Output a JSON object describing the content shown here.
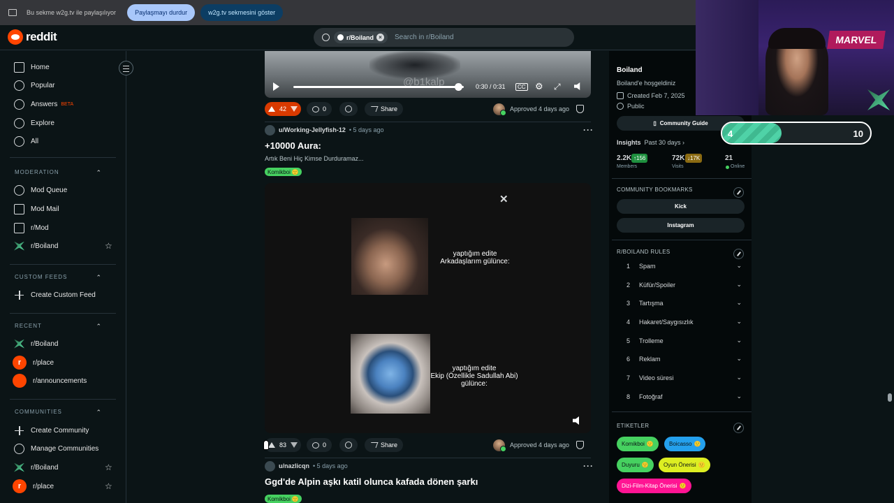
{
  "sharebar": {
    "message": "Bu sekme w2g.tv ile paylaşılıyor",
    "stop_label": "Paylaşmayı durdur",
    "show_label": "w2g.tv sekmesini göster"
  },
  "header": {
    "logo_text": "reddit",
    "search_chip": "r/Boiland",
    "search_placeholder": "Search in r/Boiland"
  },
  "sidebar": {
    "main": [
      "Home",
      "Popular",
      "Answers",
      "Explore",
      "All"
    ],
    "answers_badge": "BETA",
    "moderation_title": "MODERATION",
    "moderation": [
      "Mod Queue",
      "Mod Mail",
      "r/Mod",
      "r/Boiland"
    ],
    "custom_feeds_title": "CUSTOM FEEDS",
    "create_custom_feed": "Create Custom Feed",
    "recent_title": "RECENT",
    "recent": [
      "r/Boiland",
      "r/place",
      "r/announcements"
    ],
    "communities_title": "COMMUNITIES",
    "create_community": "Create Community",
    "manage_communities": "Manage Communities",
    "communities": [
      "r/Boiland",
      "r/place"
    ]
  },
  "feed": {
    "video": {
      "time": "0:30 / 0:31",
      "watermark": "@b1kalp",
      "progress": 0.97
    },
    "post0": {
      "votes": "42",
      "comments": "0",
      "share": "Share",
      "approved": "Approved 4 days ago"
    },
    "post1": {
      "user": "u/Working-Jellyfish-12",
      "age": "• 5 days ago",
      "title": "+10000 Aura:",
      "body": "Artık Beni Hiç Kimse Durduramaz...",
      "flair": "Komikboi",
      "caption1": "yaptığım edite\nArkadaşlarım gülünce:",
      "caption2": "yaptığım edite\nEkip (Özellikle Sadullah Abi)\ngülünce:",
      "votes": "83",
      "comments": "0",
      "share": "Share",
      "approved": "Approved 4 days ago"
    },
    "post2": {
      "user": "u/nazlicqn",
      "age": "• 5 days ago",
      "title": "Ggd'de Alpin aşkı katil olunca kafada dönen şarkı",
      "flair": "Komikboi"
    }
  },
  "rightbar": {
    "name": "Boiland",
    "welcome": "Boiland'e hoşgeldiniz",
    "created": "Created Feb 7, 2025",
    "visibility": "Public",
    "guide_button": "Community Guide",
    "insights_label": "Insights",
    "insights_period": "Past 30 days ›",
    "members": "2.2K",
    "members_label": "Members",
    "members_delta": "↑156",
    "visits": "72K",
    "visits_label": "Visits",
    "visits_delta": "↓17K",
    "online": "21",
    "online_label": "Online",
    "bookmarks_title": "COMMUNITY BOOKMARKS",
    "bookmarks": [
      "Kick",
      "Instagram"
    ],
    "rules_title": "R/BOILAND RULES",
    "rules": [
      {
        "n": "1",
        "label": "Spam"
      },
      {
        "n": "2",
        "label": "Küfür/Spoiler"
      },
      {
        "n": "3",
        "label": "Tartışma"
      },
      {
        "n": "4",
        "label": "Hakaret/Saygısızlık"
      },
      {
        "n": "5",
        "label": "Trolleme"
      },
      {
        "n": "6",
        "label": "Reklam"
      },
      {
        "n": "7",
        "label": "Video süresi"
      },
      {
        "n": "8",
        "label": "Fotoğraf"
      }
    ],
    "tags_title": "ETIKETLER",
    "tags": [
      {
        "label": "Komikboi",
        "color": "#46d160"
      },
      {
        "label": "Boicasso",
        "color": "#24a0ed"
      },
      {
        "label": "Duyuru",
        "color": "#46d160"
      },
      {
        "label": "Oyun Önerisi",
        "color": "#ddee22"
      },
      {
        "label": "Dizi-Film-Kitap Önerisi",
        "color": "#ff1493"
      }
    ]
  },
  "overlay": {
    "cam_sign": "MARVEL",
    "counter_current": "4",
    "counter_max": "10",
    "counter_fraction": 0.4
  },
  "colors": {
    "accent": "#ff4500",
    "background": "#0b1416",
    "upvote_active": "#d93a00"
  }
}
